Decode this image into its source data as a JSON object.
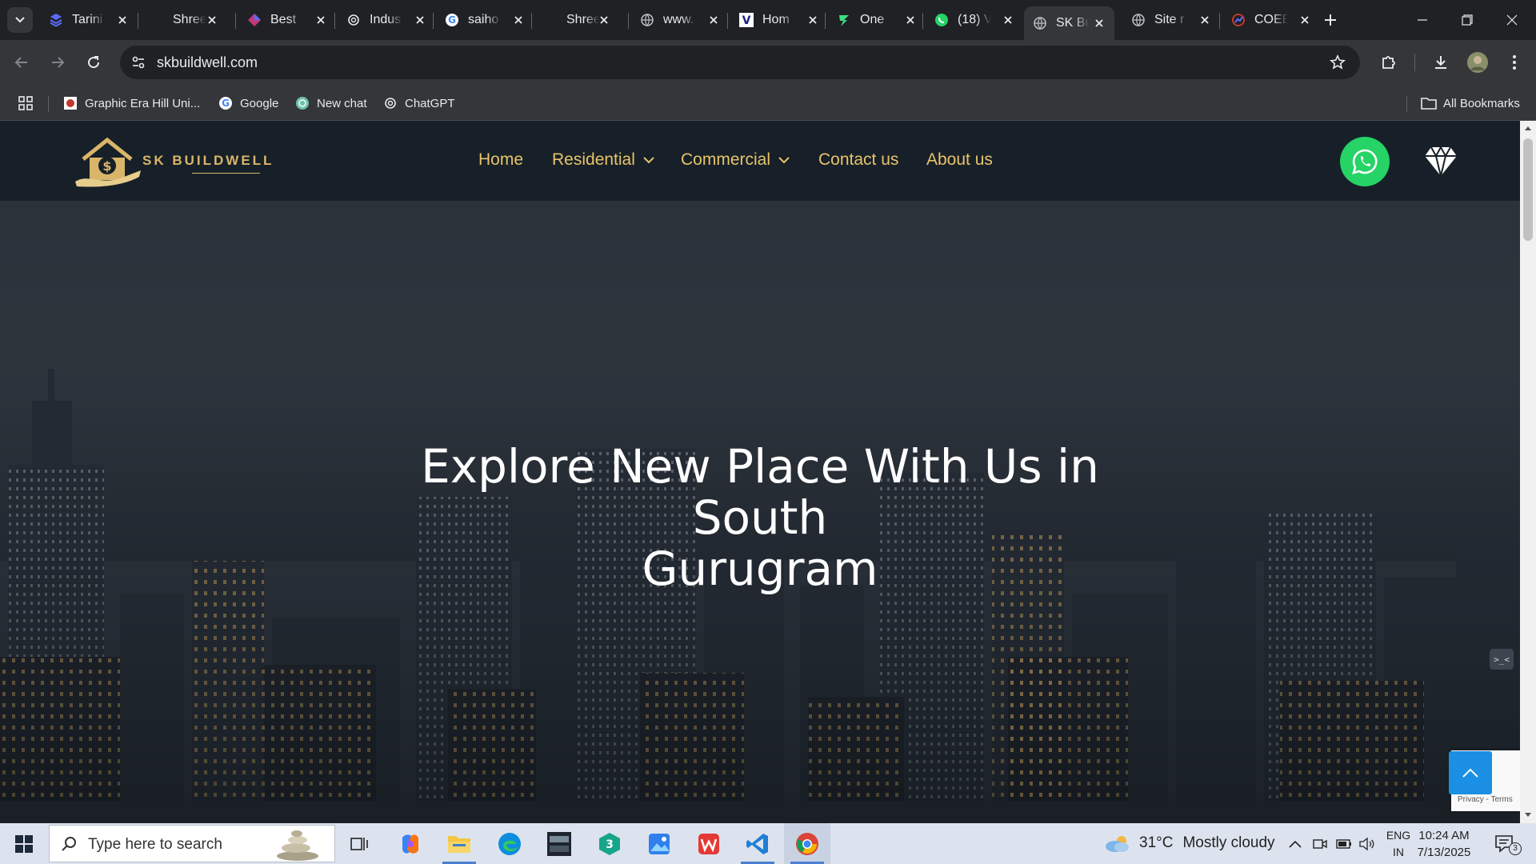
{
  "browser": {
    "tabs": [
      {
        "label": "Tarini",
        "icon": "layers-icon"
      },
      {
        "label": "Shree",
        "icon": "none"
      },
      {
        "label": "Best",
        "icon": "diamond-icon"
      },
      {
        "label": "Indus",
        "icon": "openai-icon"
      },
      {
        "label": "saiho",
        "icon": "google-icon"
      },
      {
        "label": "Shree",
        "icon": "none"
      },
      {
        "label": "www.",
        "icon": "globe-icon"
      },
      {
        "label": "Hom",
        "icon": "v-icon"
      },
      {
        "label": "One",
        "icon": "bolt-icon"
      },
      {
        "label": "(18) V",
        "icon": "whatsapp-icon"
      },
      {
        "label": "SK Bu",
        "icon": "globe-icon",
        "active": true
      },
      {
        "label": "Site r",
        "icon": "globe-icon"
      },
      {
        "label": "COEE",
        "icon": "chart-icon"
      }
    ],
    "url": "skbuildwell.com",
    "bookmarks": [
      {
        "label": "Graphic Era Hill Uni...",
        "icon": "university-icon"
      },
      {
        "label": "Google",
        "icon": "google-icon"
      },
      {
        "label": "New chat",
        "icon": "chat-icon"
      },
      {
        "label": "ChatGPT",
        "icon": "openai-icon"
      }
    ],
    "all_bookmarks_label": "All Bookmarks"
  },
  "site": {
    "logo_text": "SK BUILDWELL",
    "nav": [
      {
        "label": "Home",
        "dropdown": false
      },
      {
        "label": "Residential",
        "dropdown": true
      },
      {
        "label": "Commercial",
        "dropdown": true
      },
      {
        "label": "Contact us",
        "dropdown": false
      },
      {
        "label": "About us",
        "dropdown": false
      }
    ],
    "hero_title_line1": "Explore New Place With Us in South",
    "hero_title_line2": "Gurugram",
    "recaptcha_links": "Privacy - Terms",
    "cmd_icon_text": ">_<",
    "colors": {
      "accent": "#e8c36b",
      "header_bg": "#172028",
      "whatsapp": "#25d366",
      "to_top": "#1a8fe3"
    }
  },
  "taskbar": {
    "search_placeholder": "Type here to search",
    "weather_temp": "31°C",
    "weather_text": "Mostly cloudy",
    "lang_line1": "ENG",
    "lang_line2": "IN",
    "time": "10:24 AM",
    "date": "7/13/2025",
    "notification_count": "3"
  }
}
